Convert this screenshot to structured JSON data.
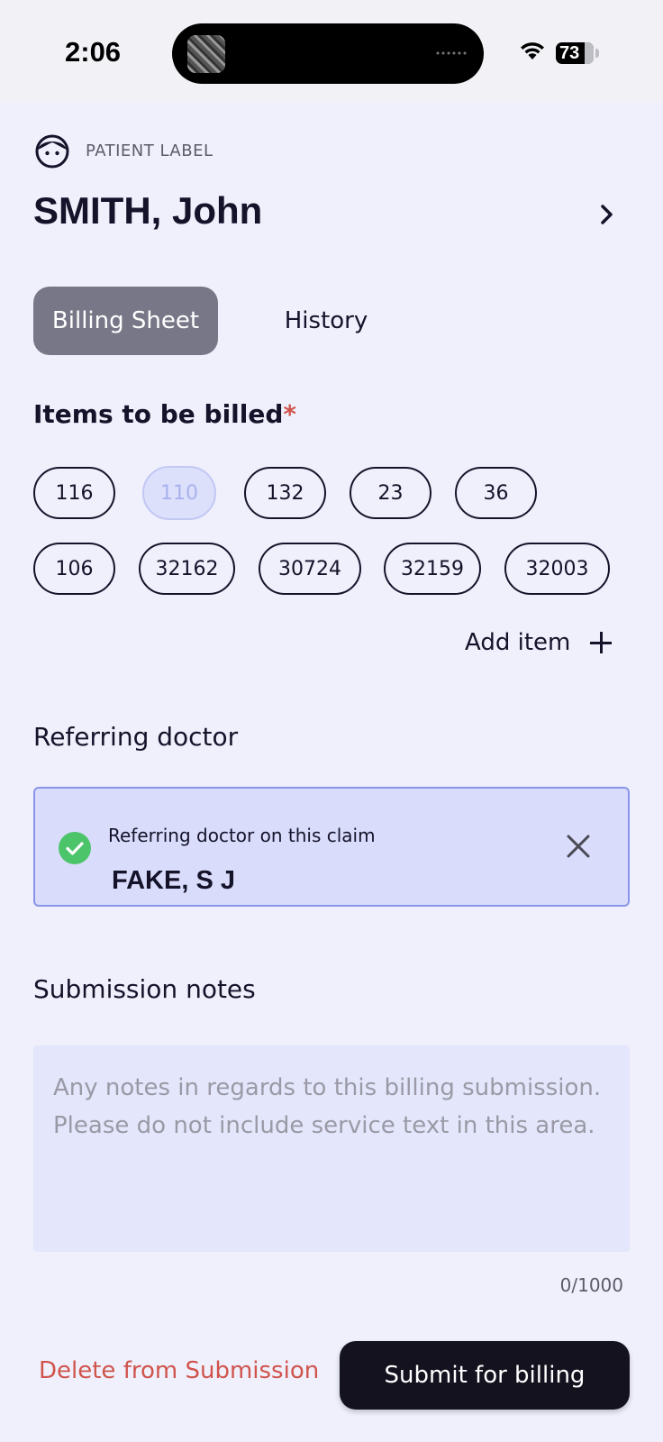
{
  "status_bar": {
    "time": "2:06",
    "battery": "73"
  },
  "patient": {
    "label": "PATIENT LABEL",
    "name": "SMITH, John"
  },
  "tabs": [
    {
      "label": "Billing Sheet",
      "active": true
    },
    {
      "label": "History",
      "active": false
    }
  ],
  "items_section": {
    "title": "Items to be billed",
    "required_marker": "*",
    "items": [
      {
        "code": "116",
        "disabled": false
      },
      {
        "code": "110",
        "disabled": true
      },
      {
        "code": "132",
        "disabled": false
      },
      {
        "code": "23",
        "disabled": false
      },
      {
        "code": "36",
        "disabled": false
      },
      {
        "code": "106",
        "disabled": false
      },
      {
        "code": "32162",
        "disabled": false
      },
      {
        "code": "30724",
        "disabled": false
      },
      {
        "code": "32159",
        "disabled": false
      },
      {
        "code": "32003",
        "disabled": false
      }
    ],
    "add_item_label": "Add item"
  },
  "referring": {
    "title": "Referring doctor",
    "caption": "Referring doctor on this claim",
    "doctor_name": "FAKE, S J"
  },
  "notes": {
    "title": "Submission notes",
    "placeholder": "Any notes in regards to this billing submission. Please do not include service text in this area.",
    "counter": "0/1000"
  },
  "footer": {
    "delete_label": "Delete from Submission",
    "submit_label": "Submit for billing"
  },
  "colors": {
    "background": "#eff0fc",
    "text": "#15132a",
    "danger": "#d0544c",
    "accent": "#8b94ea",
    "success": "#4cc46a"
  }
}
